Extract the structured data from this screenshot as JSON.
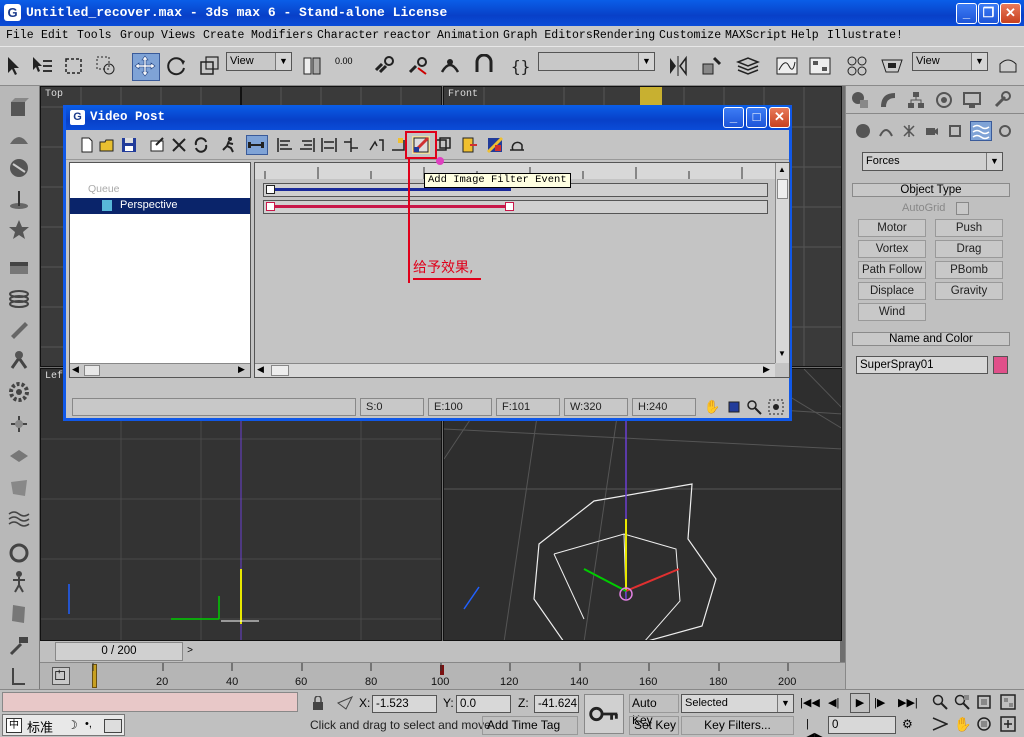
{
  "window": {
    "title": "Untitled_recover.max - 3ds max 6 - Stand-alone License",
    "icon": "G"
  },
  "menu": [
    "File",
    "Edit",
    "Tools",
    "Group",
    "Views",
    "Create",
    "Modifiers",
    "Character",
    "reactor",
    "Animation",
    "Graph Editors",
    "Rendering",
    "Customize",
    "MAXScript",
    "Help",
    "Illustrate!"
  ],
  "toolbar": {
    "view_combo_1": "View",
    "view_combo_2": "View",
    "spinner_value": "0.00",
    "named_sel": ""
  },
  "viewports": {
    "top_label": "Top",
    "front_label": "Front",
    "left_label": "Lef"
  },
  "command_panel": {
    "category": "Forces",
    "object_type_title": "Object Type",
    "autogrid_label": "AutoGrid",
    "buttons": [
      "Motor",
      "Push",
      "Vortex",
      "Drag",
      "Path Follow",
      "PBomb",
      "Displace",
      "Gravity",
      "Wind"
    ],
    "name_color_title": "Name and Color",
    "object_name": "SuperSpray01",
    "object_color": "#e0508a"
  },
  "video_post": {
    "title": "Video Post",
    "queue_label": "Queue",
    "queue_item": "Perspective",
    "tooltip": "Add Image Filter Event",
    "annotation": "给予效果,",
    "status": {
      "s": "S:0",
      "e": "E:100",
      "f": "F:101",
      "w": "W:320",
      "h": "H:240"
    }
  },
  "timeline": {
    "frame_display": "0 / 200",
    "ticks": [
      "20",
      "40",
      "60",
      "80",
      "100",
      "120",
      "140",
      "160",
      "180",
      "200"
    ]
  },
  "status_bar": {
    "x_label": "X:",
    "x_value": "-1.523",
    "y_label": "Y:",
    "y_value": "0.0",
    "z_label": "Z:",
    "z_value": "-41.624",
    "prompt": "Click and drag to select and move",
    "add_time_tag": "Add Time Tag",
    "auto_key": "Auto Key",
    "set_key": "Set Key",
    "selected": "Selected",
    "key_filters": "Key Filters...",
    "frame_field": "0",
    "ime_label": "标准"
  },
  "colors": {
    "title_blue": "#0a4cd8",
    "annotation_red": "#e0001a",
    "queue_select": "#0a246a"
  }
}
